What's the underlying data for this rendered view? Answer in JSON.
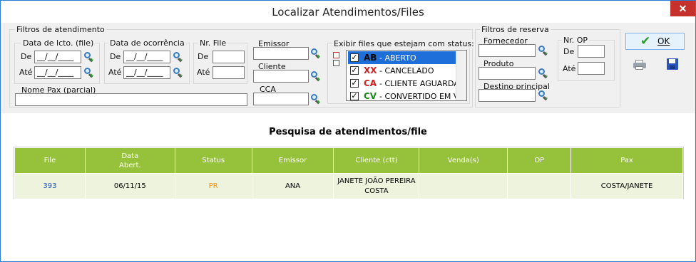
{
  "window": {
    "title": "Localizar Atendimentos/Files",
    "close_glyph": "✕"
  },
  "filters": {
    "group_title": "Filtros de atendimento",
    "data_lcto": {
      "title": "Data de lcto. (file)",
      "de_label": "De",
      "ate_label": "Até",
      "de_value": "__/__/____",
      "ate_value": "__/__/____"
    },
    "data_ocorr": {
      "title": "Data de ocorrência",
      "de_label": "De",
      "ate_label": "Até",
      "de_value": "__/__/____",
      "ate_value": "__/__/____"
    },
    "nr_file": {
      "title": "Nr. File",
      "de_label": "De",
      "ate_label": "Até"
    },
    "emissor": {
      "label": "Emissor"
    },
    "cliente": {
      "label": "Cliente"
    },
    "cca": {
      "label": "CCA"
    },
    "nome_pax": {
      "label": "Nome Pax (parcial)"
    },
    "status": {
      "title": "Exibir files que estejam com status:",
      "items": [
        {
          "code": "AB",
          "desc": "- ABERTO",
          "checked": "✓",
          "color": "#000000"
        },
        {
          "code": "XX",
          "desc": "- CANCELADO",
          "checked": "✓",
          "color": "#d22020"
        },
        {
          "code": "CA",
          "desc": "- CLIENTE AGUARDA",
          "checked": "✓",
          "color": "#d22020"
        },
        {
          "code": "CV",
          "desc": "- CONVERTIDO EM VI",
          "checked": "✓",
          "color": "#1a8a1a"
        }
      ]
    }
  },
  "reserva": {
    "group_title": "Filtros de reserva",
    "fornecedor": "Fornecedor",
    "produto": "Produto",
    "destino": "Destino principal",
    "nr_op": {
      "title": "Nr. OP",
      "de_label": "De",
      "ate_label": "Até"
    }
  },
  "actions": {
    "ok_label": "OK",
    "ok_icon": "checkmark-icon",
    "print_icon": "printer-icon",
    "save_icon": "floppy-disk-icon"
  },
  "results": {
    "heading": "Pesquisa de atendimentos/file",
    "columns": [
      "File",
      "Data\nAbert.",
      "Status",
      "Emissor",
      "Cliente (ctt)",
      "Venda(s)",
      "OP",
      "Pax"
    ],
    "rows": [
      {
        "file": "393",
        "data": "06/11/15",
        "status": "PR",
        "emissor": "ANA",
        "cliente": "JANETE JOÃO PEREIRA\nCOSTA",
        "vendas": "",
        "op": "",
        "pax": "COSTA/JANETE"
      }
    ],
    "colors": {
      "header": "#96c13a",
      "row": "#edf3dc",
      "file_link": "#1e50c8",
      "status_pr": "#e8901a"
    }
  }
}
